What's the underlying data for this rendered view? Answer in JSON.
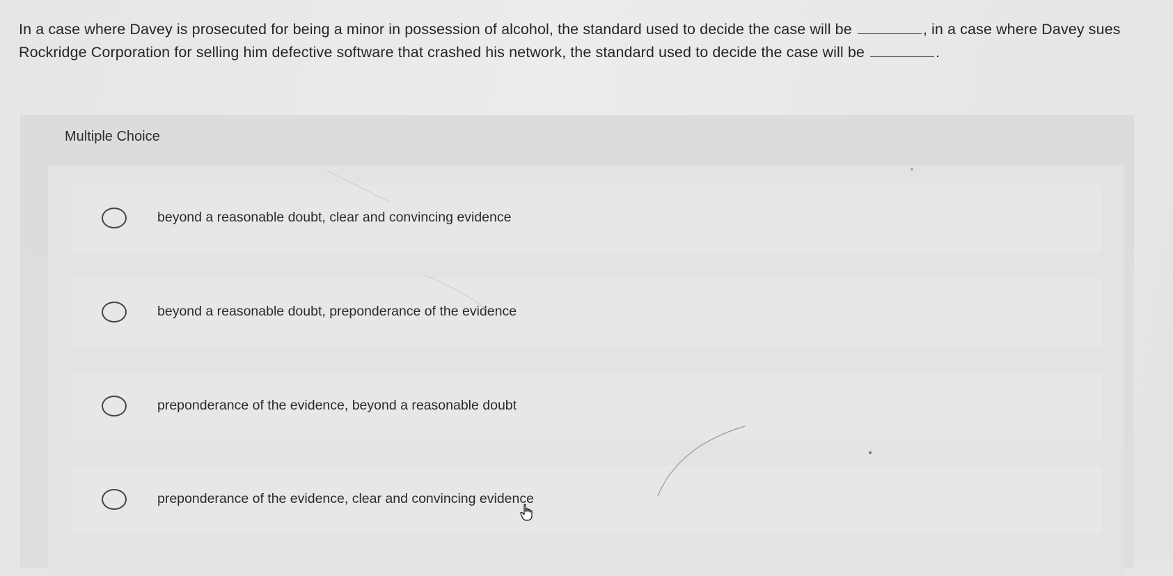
{
  "question": {
    "part1": "In a case where Davey is prosecuted for being a minor in possession of alcohol, the standard used to decide the case will be",
    "part2": ", in a case where Davey sues Rockridge Corporation for selling him defective software that crashed his network, the standard used to decide the case will be",
    "part3": "."
  },
  "multiple_choice": {
    "header": "Multiple Choice",
    "options": [
      {
        "label": "beyond a reasonable doubt, clear and convincing evidence",
        "selected": false
      },
      {
        "label": "beyond a reasonable doubt, preponderance of the evidence",
        "selected": false
      },
      {
        "label": "preponderance of the evidence, beyond a reasonable doubt",
        "selected": false
      },
      {
        "label": "preponderance of the evidence, clear and convincing evidence",
        "selected": false
      }
    ]
  },
  "icons": {
    "cursor": "hand-pointer-icon",
    "radio": "radio-button-icon"
  },
  "colors": {
    "page_background": "#e8e8e6",
    "panel_background": "#dcdcda",
    "option_background": "#e7e7e5",
    "text": "#2a2a2a"
  }
}
